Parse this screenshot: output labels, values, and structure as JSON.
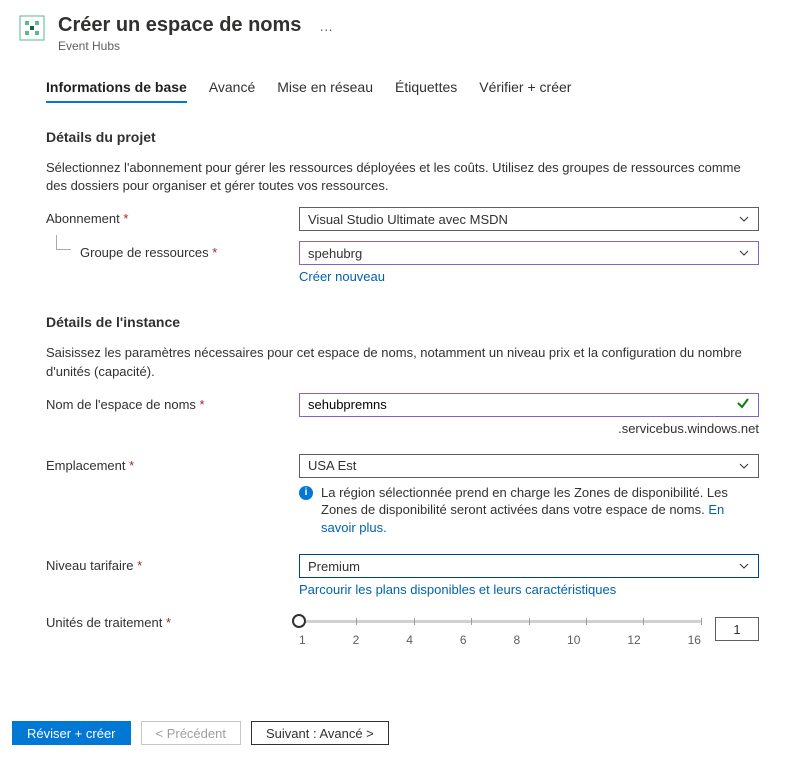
{
  "header": {
    "title": "Créer un espace de noms",
    "subtitle": "Event Hubs",
    "ellipsis": "…"
  },
  "tabs": {
    "basic": "Informations de base",
    "advanced": "Avancé",
    "networking": "Mise en réseau",
    "tags": "Étiquettes",
    "review": "Vérifier + créer"
  },
  "project": {
    "section_title": "Détails du projet",
    "section_desc": "Sélectionnez l'abonnement pour gérer les ressources déployées et les coûts. Utilisez des groupes de ressources comme des dossiers pour organiser et gérer toutes vos ressources.",
    "subscription_label": "Abonnement",
    "subscription_value": "Visual Studio Ultimate avec MSDN",
    "rg_label": "Groupe de ressources",
    "rg_value": "spehubrg",
    "rg_create_new": "Créer nouveau"
  },
  "instance": {
    "section_title": "Détails de l'instance",
    "section_desc": "Saisissez les paramètres nécessaires pour cet espace de noms, notamment un niveau prix et la configuration du nombre d'unités (capacité).",
    "ns_label": "Nom de l'espace de noms",
    "ns_value": "sehubpremns",
    "ns_suffix": ".servicebus.windows.net",
    "location_label": "Emplacement",
    "location_value": "USA Est",
    "info_text": "La région sélectionnée prend en charge les Zones de disponibilité. Les Zones de disponibilité seront activées dans votre espace de noms. ",
    "info_link": "En savoir plus.",
    "tier_label": "Niveau tarifaire",
    "tier_value": "Premium",
    "tier_link": "Parcourir les plans disponibles et leurs caractéristiques",
    "pu_label": "Unités de traitement",
    "pu_value": "1",
    "pu_ticks": [
      "1",
      "2",
      "4",
      "6",
      "8",
      "10",
      "12",
      "16"
    ]
  },
  "footer": {
    "review": "Réviser + créer",
    "prev": "< Précédent",
    "next": "Suivant : Avancé >"
  },
  "colors": {
    "primary": "#0078d4",
    "purple_border": "#8661c5",
    "green": "#107c10",
    "required": "#a4262c"
  }
}
